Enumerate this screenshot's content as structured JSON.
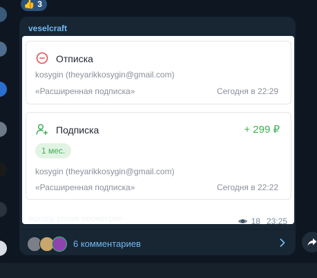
{
  "reaction": {
    "emoji": "👍",
    "count": "3"
  },
  "message": {
    "sender": "veselcraft",
    "caption": "походу ролик посмотрел",
    "views": "18",
    "time": "23:25"
  },
  "cards": [
    {
      "title": "Отписка",
      "email": "kosygin (theyarikkosygin@gmail.com)",
      "plan": "«Расширенная подписка»",
      "date": "Сегодня в 22:29"
    },
    {
      "title": "Подписка",
      "amount": "+ 299 ₽",
      "badge": "1 мес.",
      "email": "kosygin (theyarikkosygin@gmail.com)",
      "plan": "«Расширенная подписка»",
      "date": "Сегодня в 22:22"
    }
  ],
  "comments": {
    "label": "6 комментариев"
  },
  "colors": {
    "background": "#0e1621",
    "bubble": "#182533",
    "accent_blue": "#71baf2",
    "unsubscribe_red": "#e04f4f",
    "subscribe_green": "#3fae55"
  },
  "icons": [
    "thumbs-up-icon",
    "minus-circle-icon",
    "user-add-icon",
    "eye-icon",
    "chevron-right-icon",
    "share-arrow-icon"
  ]
}
